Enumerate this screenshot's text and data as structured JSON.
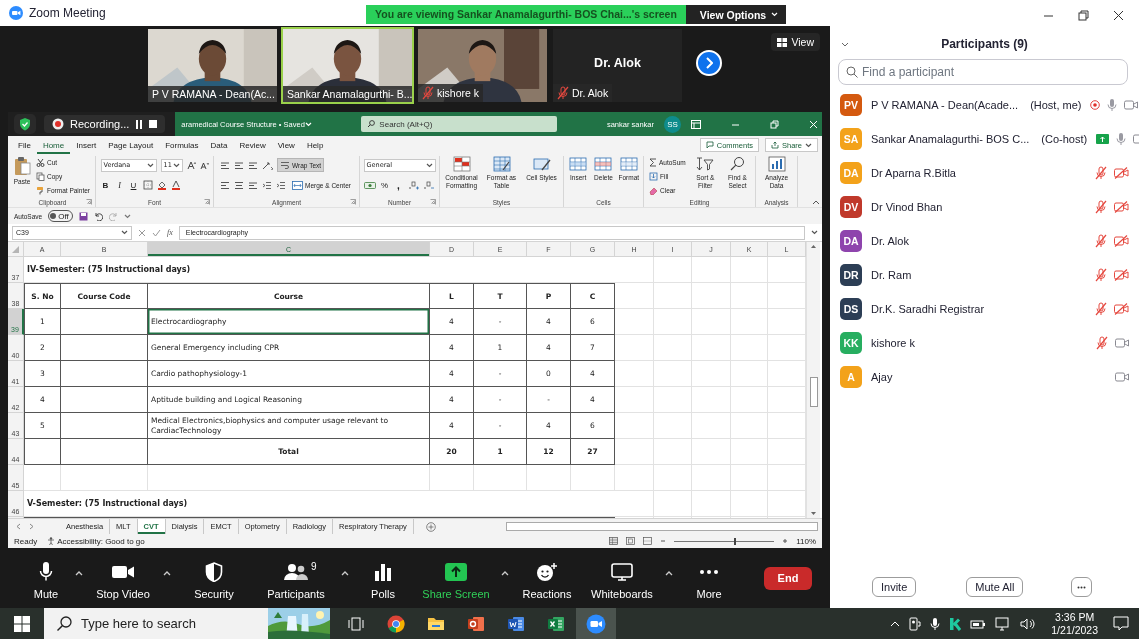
{
  "window": {
    "title": "Zoom Meeting"
  },
  "share_banner": {
    "text": "You are viewing Sankar Anamalagurthi- BOS Chai...'s screen",
    "button": "View Options"
  },
  "video_strip": {
    "tiles": [
      {
        "kind": "video",
        "name": "P V RAMANA - Dean(Ac...",
        "muted": false,
        "selected": false
      },
      {
        "kind": "video",
        "name": "Sankar Anamalagurthi- B...",
        "muted": false,
        "selected": true
      },
      {
        "kind": "video",
        "name": "kishore k",
        "muted": true,
        "selected": false
      },
      {
        "kind": "name_only",
        "display_name": "Dr. Alok",
        "name": "Dr. Alok",
        "muted": true,
        "selected": false
      }
    ],
    "view_button": "View"
  },
  "recording": {
    "label": "Recording..."
  },
  "excel": {
    "title": "aramedical Course Structure • Saved",
    "search": {
      "placeholder": "Search (Alt+Q)"
    },
    "user": "sankar sankar",
    "initials": "SS",
    "menu": [
      {
        "label": "File",
        "selected": false
      },
      {
        "label": "Home",
        "selected": true
      },
      {
        "label": "Insert",
        "selected": false
      },
      {
        "label": "Page Layout",
        "selected": false
      },
      {
        "label": "Formulas",
        "selected": false
      },
      {
        "label": "Data",
        "selected": false
      },
      {
        "label": "Review",
        "selected": false
      },
      {
        "label": "View",
        "selected": false
      },
      {
        "label": "Help",
        "selected": false
      }
    ],
    "comments": "Comments",
    "share": "Share",
    "ribbon": [
      {
        "kind": "clipboard",
        "label": "Clipboard",
        "paste": "Paste",
        "cut": "Cut",
        "copy": "Copy",
        "painter": "Format Painter"
      },
      {
        "kind": "font",
        "label": "Font",
        "font": "Verdana",
        "size": "11",
        "bold": "B",
        "italic": "I",
        "underline": "U"
      },
      {
        "kind": "alignment",
        "label": "Alignment",
        "wrap": {
          "label": "Wrap Text",
          "on": true
        },
        "merge": "Merge & Center"
      },
      {
        "kind": "number",
        "label": "Number",
        "format": "General",
        "percent": "%",
        "comma": ","
      },
      {
        "kind": "styles",
        "label": "Styles",
        "buttons": [
          "Conditional Formatting",
          "Format as Table",
          "Cell Styles"
        ]
      },
      {
        "kind": "cells",
        "label": "Cells",
        "buttons": [
          "Insert",
          "Delete",
          "Format"
        ]
      },
      {
        "kind": "editing",
        "label": "Editing",
        "autosum": "AutoSum",
        "fill": "Fill",
        "clear": "Clear",
        "sort": "Sort & Filter",
        "find": "Find & Select"
      },
      {
        "kind": "analysis",
        "label": "Analysis",
        "button": "Analyze Data"
      }
    ],
    "autosave": {
      "label": "AutoSave",
      "on": false,
      "state_text": "Off"
    },
    "name_box": "C39",
    "fx": "fx",
    "formula": "Electrocardiography",
    "columns": [
      {
        "label": "A",
        "selected": false
      },
      {
        "label": "B",
        "selected": false
      },
      {
        "label": "C",
        "selected": true
      },
      {
        "label": "D",
        "selected": false
      },
      {
        "label": "E",
        "selected": false
      },
      {
        "label": "F",
        "selected": false
      },
      {
        "label": "G",
        "selected": false
      },
      {
        "label": "H",
        "selected": false
      },
      {
        "label": "I",
        "selected": false
      },
      {
        "label": "J",
        "selected": false
      },
      {
        "label": "K",
        "selected": false
      },
      {
        "label": "L",
        "selected": false
      }
    ],
    "rows": [
      {
        "number": "37",
        "kind": "heading",
        "text": "IV-Semester: (75 Instructional days)"
      },
      {
        "number": "38",
        "kind": "header",
        "cells": [
          "S. No",
          "Course Code",
          "Course",
          "L",
          "T",
          "P",
          "C"
        ]
      },
      {
        "number": "39",
        "kind": "course",
        "selected": true,
        "s_no": "1",
        "course": "Electrocardiography",
        "l": "4",
        "t": "-",
        "p": "4",
        "c": "6"
      },
      {
        "number": "40",
        "kind": "course",
        "selected": false,
        "s_no": "2",
        "course": "General Emergency including CPR",
        "l": "4",
        "t": "1",
        "p": "4",
        "c": "7"
      },
      {
        "number": "41",
        "kind": "course",
        "selected": false,
        "s_no": "3",
        "course": "Cardio pathophysiology-1",
        "l": "4",
        "t": "-",
        "p": "0",
        "c": "4"
      },
      {
        "number": "42",
        "kind": "course",
        "selected": false,
        "s_no": "4",
        "course": "Aptitude building and Logical Reasoning",
        "l": "4",
        "t": "-",
        "p": "-",
        "c": "4"
      },
      {
        "number": "43",
        "kind": "course",
        "selected": false,
        "s_no": "5",
        "course": "Medical Electronics,biophysics and computer usage relevant to CardiacTechnology",
        "l": "4",
        "t": "-",
        "p": "4",
        "c": "6"
      },
      {
        "number": "44",
        "kind": "total",
        "label": "Total",
        "l": "20",
        "t": "1",
        "p": "12",
        "c": "27"
      },
      {
        "number": "45",
        "kind": "blank"
      },
      {
        "number": "46",
        "kind": "heading",
        "text": "V-Semester: (75 Instructional days)"
      }
    ],
    "sheet_tabs": [
      {
        "label": "Anesthesia",
        "selected": false
      },
      {
        "label": "MLT",
        "selected": false
      },
      {
        "label": "CVT",
        "selected": true
      },
      {
        "label": "Dialysis",
        "selected": false
      },
      {
        "label": "EMCT",
        "selected": false
      },
      {
        "label": "Optometry",
        "selected": false
      },
      {
        "label": "Radiology",
        "selected": false
      },
      {
        "label": "Respiratory Therapy",
        "selected": false
      }
    ],
    "status": {
      "ready": "Ready",
      "accessibility": "Accessibility: Good to go",
      "zoom": "110%"
    },
    "zoom_slider": {
      "level": 0.6
    }
  },
  "toolbar": {
    "items": [
      {
        "kind": "mic",
        "label": "Mute",
        "caret": true
      },
      {
        "kind": "camera",
        "label": "Stop Video",
        "caret": true
      },
      {
        "kind": "security",
        "label": "Security",
        "caret": false
      },
      {
        "kind": "participants",
        "label": "Participants",
        "caret": true,
        "badge": "9"
      },
      {
        "kind": "polls",
        "label": "Polls",
        "caret": false
      },
      {
        "kind": "share",
        "label": "Share Screen",
        "caret": true
      },
      {
        "kind": "reactions",
        "label": "Reactions",
        "caret": false
      },
      {
        "kind": "whiteboards",
        "label": "Whiteboards",
        "caret": true
      },
      {
        "kind": "more",
        "label": "More",
        "caret": false
      }
    ],
    "end": "End"
  },
  "participants_panel": {
    "title": "Participants (9)",
    "search": {
      "placeholder": "Find a participant"
    },
    "people": [
      {
        "initials": "PV",
        "color": "#d4590f",
        "name": "P V RAMANA - Dean(Acade...",
        "role": "(Host, me)",
        "recording": true,
        "sharing": false,
        "in_audio": true,
        "muted": false,
        "video_off": false
      },
      {
        "initials": "SA",
        "color": "#f3a21a",
        "name": "Sankar Anamalagurthi- BOS C...",
        "role": "(Co-host)",
        "recording": false,
        "sharing": true,
        "in_audio": true,
        "muted": false,
        "video_off": false
      },
      {
        "initials": "DA",
        "color": "#f3a21a",
        "name": "Dr Aparna R.Bitla",
        "recording": false,
        "sharing": false,
        "in_audio": true,
        "muted": true,
        "video_off": true
      },
      {
        "initials": "DV",
        "color": "#c0392b",
        "name": "Dr Vinod Bhan",
        "recording": false,
        "sharing": false,
        "in_audio": true,
        "muted": true,
        "video_off": true
      },
      {
        "initials": "DA",
        "color": "#8e44ad",
        "name": "Dr. Alok",
        "recording": false,
        "sharing": false,
        "in_audio": true,
        "muted": true,
        "video_off": true
      },
      {
        "initials": "DR",
        "color": "#2c3e55",
        "name": "Dr. Ram",
        "recording": false,
        "sharing": false,
        "in_audio": true,
        "muted": true,
        "video_off": true
      },
      {
        "initials": "DS",
        "color": "#2c3e55",
        "name": "Dr.K. Saradhi Registrar",
        "recording": false,
        "sharing": false,
        "in_audio": true,
        "muted": true,
        "video_off": true
      },
      {
        "initials": "KK",
        "color": "#27ae60",
        "name": "kishore k",
        "recording": false,
        "sharing": false,
        "in_audio": true,
        "muted": true,
        "video_off": false
      },
      {
        "initials": "A",
        "color": "#f3a21a",
        "name": "Ajay",
        "recording": false,
        "sharing": false,
        "in_audio": false,
        "video_off": false
      }
    ],
    "buttons": [
      "Invite",
      "Mute All"
    ]
  },
  "taskbar": {
    "search": {
      "placeholder": "Type here to search"
    },
    "apps": [
      {
        "kind": "task_view",
        "active": false
      },
      {
        "kind": "browser",
        "active": false
      },
      {
        "kind": "folder",
        "active": false
      },
      {
        "kind": "slides",
        "active": false
      },
      {
        "kind": "document",
        "active": false
      },
      {
        "kind": "spreadsheet",
        "active": false
      },
      {
        "kind": "meeting",
        "active": true
      }
    ],
    "clock": {
      "time": "3:36 PM",
      "date": "1/21/2023"
    }
  }
}
